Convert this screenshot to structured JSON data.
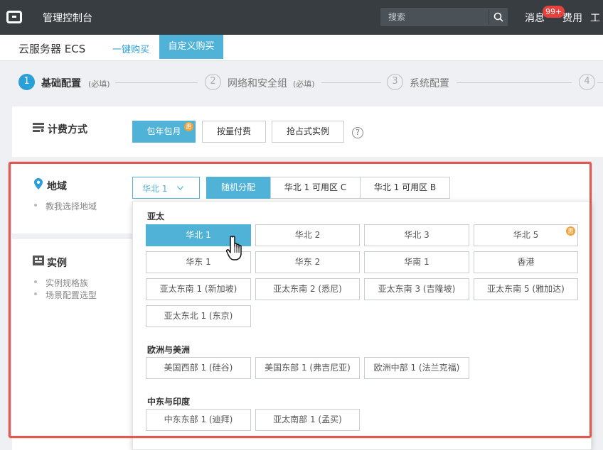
{
  "topbar": {
    "title": "管理控制台",
    "search_placeholder": "搜索",
    "messages": "消息",
    "messages_badge": "99+",
    "fees": "费用",
    "more": "工"
  },
  "product": {
    "title": "云服务器 ECS",
    "tab_quick": "一键购买",
    "tab_custom": "自定义购买"
  },
  "steps": [
    {
      "num": "1",
      "label": "基础配置",
      "note": "(必填)"
    },
    {
      "num": "2",
      "label": "网络和安全组",
      "note": "(必填)"
    },
    {
      "num": "3",
      "label": "系统配置",
      "note": ""
    },
    {
      "num": "4",
      "label": "",
      "note": ""
    }
  ],
  "billing": {
    "title": "计费方式",
    "options": [
      "包年包月",
      "按量付费",
      "抢占式实例"
    ],
    "selected": "包年包月",
    "promo_badge": "惠",
    "help": "?"
  },
  "region": {
    "title": "地域",
    "hint": "教我选择地域",
    "selected_region": "华北 1",
    "zones": [
      "随机分配",
      "华北 1 可用区 C",
      "华北 1 可用区 B"
    ],
    "selected_zone": "随机分配"
  },
  "instance": {
    "title": "实例",
    "hints": [
      "实例规格族",
      "场景配置选型"
    ]
  },
  "dropdown": {
    "groups": [
      {
        "title": "亚太",
        "items": [
          "华北 1",
          "华北 2",
          "华北 3",
          "华北 5",
          "华东 1",
          "华东 2",
          "华南 1",
          "香港",
          "亚太东南 1 (新加坡)",
          "亚太东南 2 (悉尼)",
          "亚太东南 3 (吉隆坡)",
          "亚太东南 5 (雅加达)",
          "亚太东北 1 (东京)"
        ]
      },
      {
        "title": "欧洲与美洲",
        "items": [
          "美国西部 1 (硅谷)",
          "美国东部 1 (弗吉尼亚)",
          "欧洲中部 1 (法兰克福)"
        ]
      },
      {
        "title": "中东与印度",
        "items": [
          "中东东部 1 (迪拜)",
          "亚太南部 1 (孟买)"
        ]
      }
    ],
    "selected": "华北 1",
    "new_badge": "惠"
  },
  "colors": {
    "accent": "#4fb2d6",
    "topbar": "#373d41",
    "highlight": "#de5a50",
    "badge": "#e5423f"
  }
}
